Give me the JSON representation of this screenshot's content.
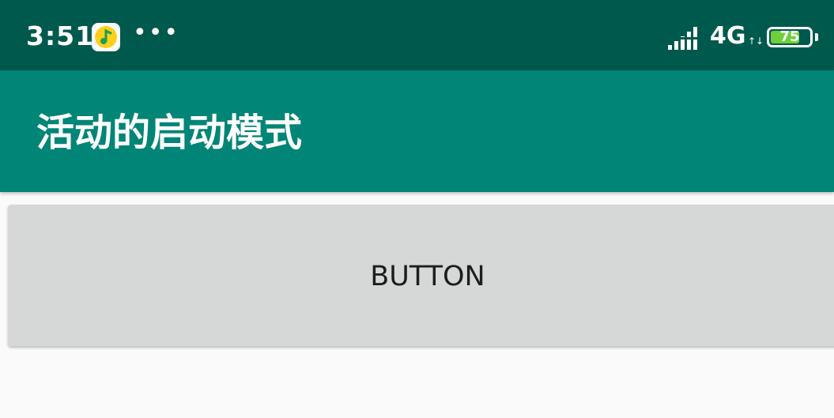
{
  "status_bar": {
    "time": "3:51",
    "notification_icon": "music-app-icon",
    "more_indicator": "•••",
    "signal_icon": "signal-bars-icon",
    "network_type": "4G",
    "data_activity": "↑↓",
    "battery_level": "75",
    "battery_percent": 75,
    "background_color": "#00594d"
  },
  "app_bar": {
    "title": "活动的启动模式",
    "background_color": "#008577"
  },
  "main": {
    "button_label": "BUTTON"
  }
}
